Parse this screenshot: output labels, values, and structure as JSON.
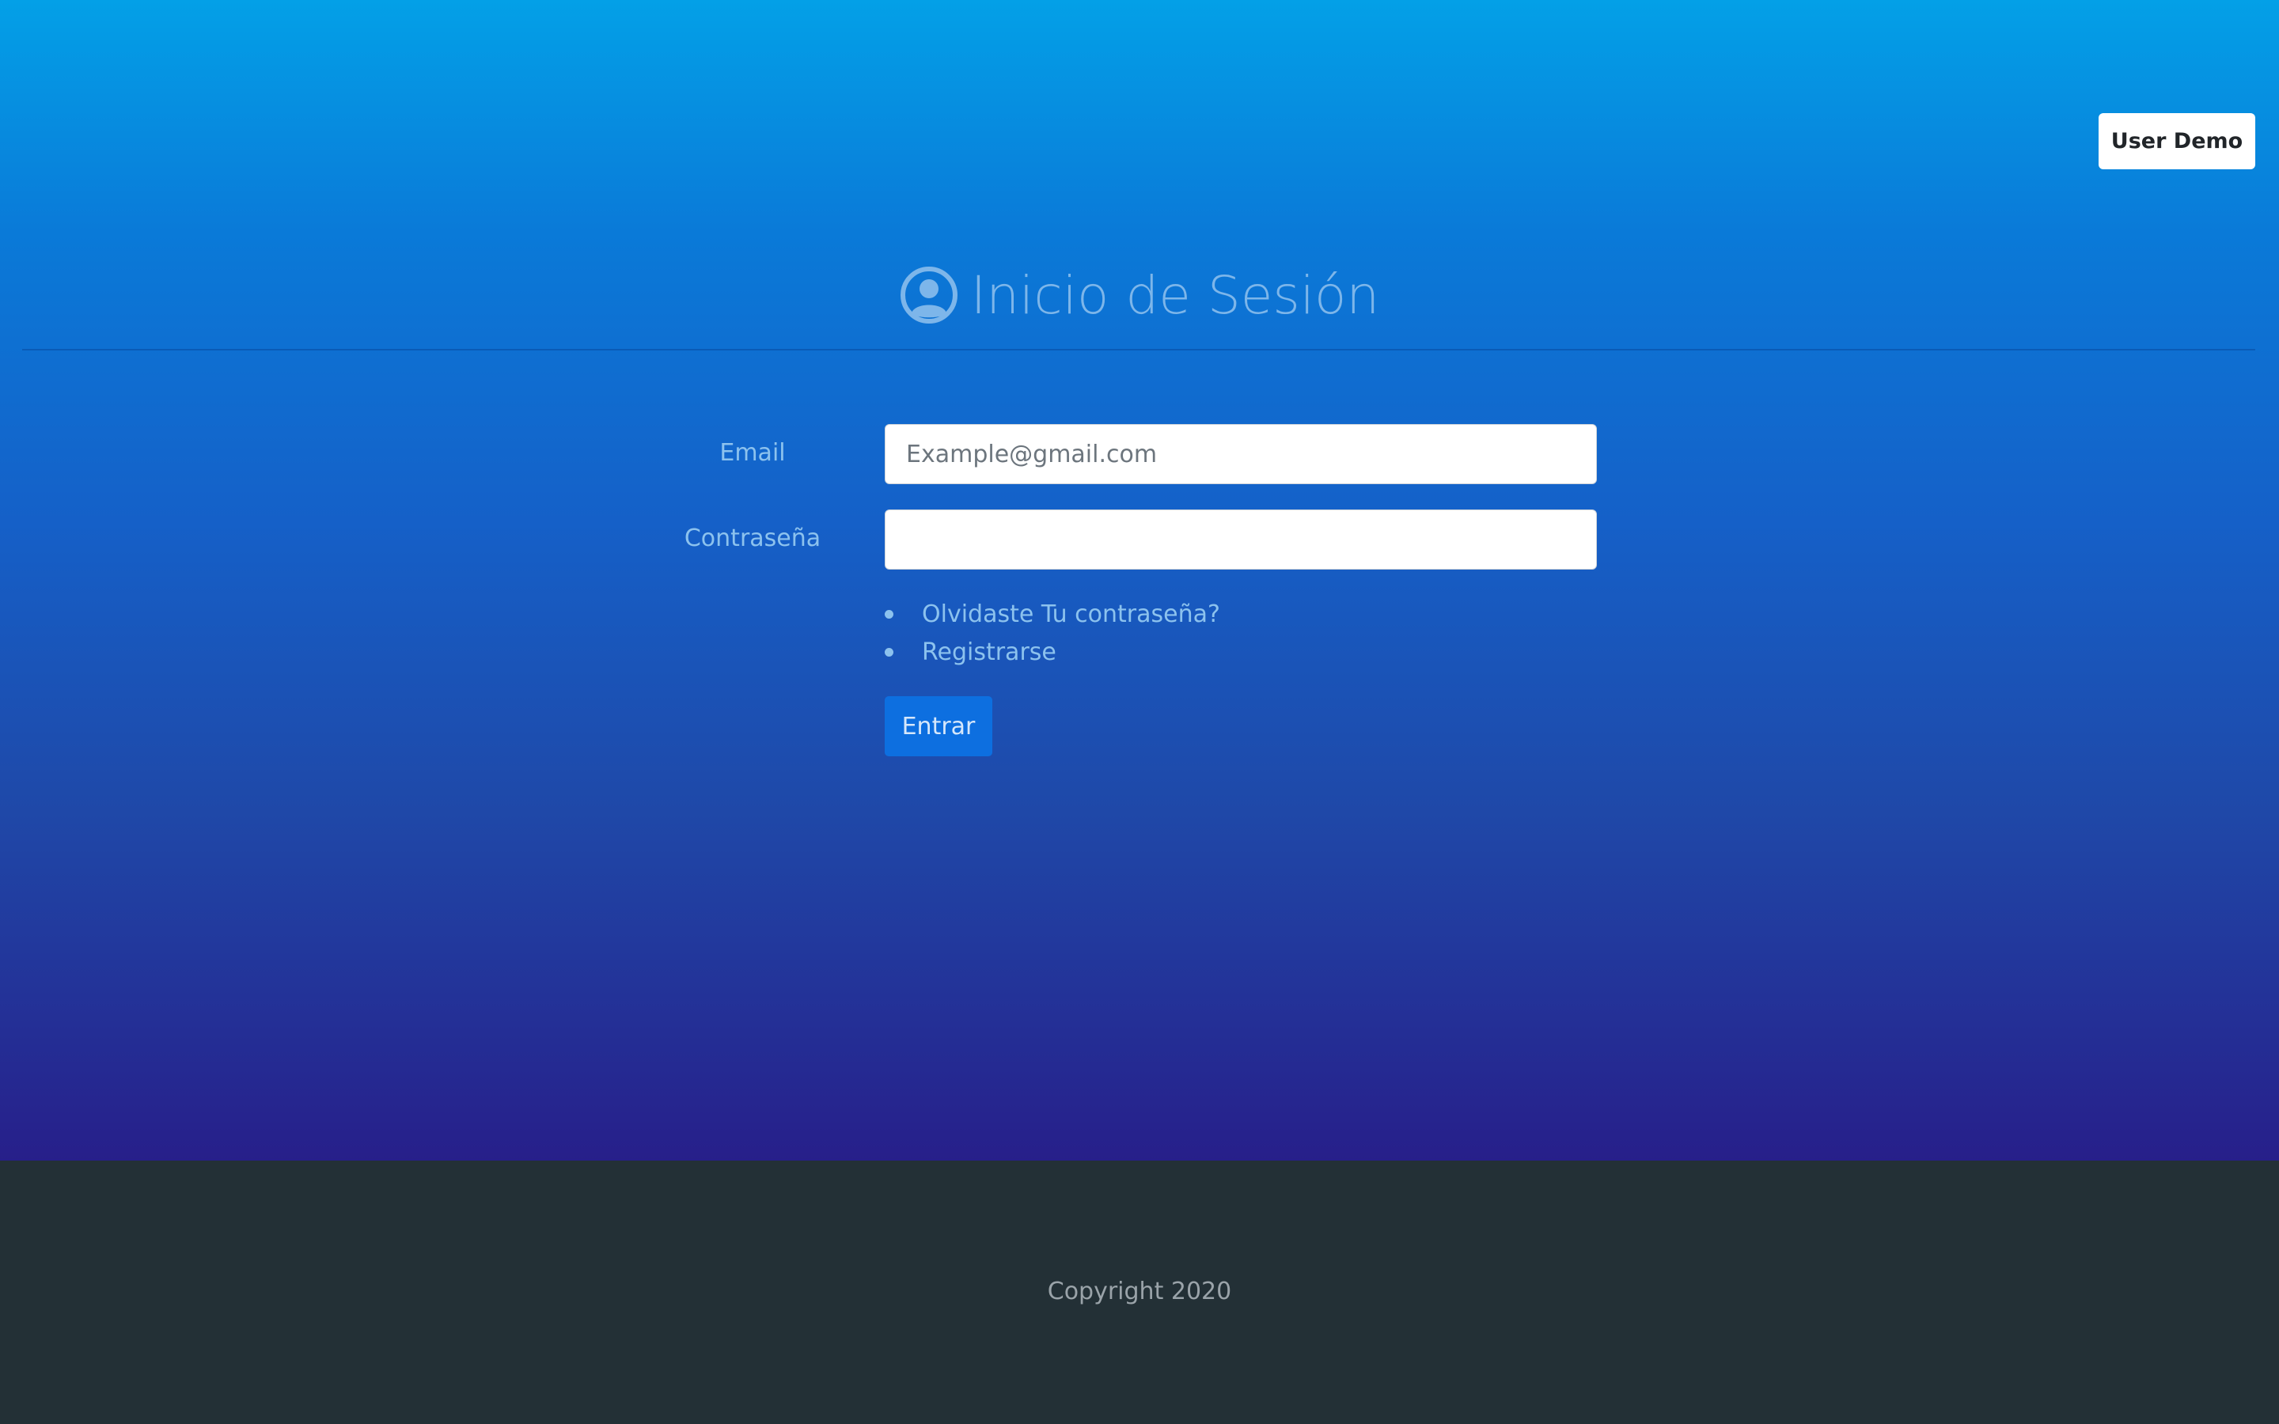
{
  "header": {
    "user_button_label": "User Demo"
  },
  "login": {
    "title": "Inicio de Sesión",
    "icon": "user-circle-icon",
    "email_label": "Email",
    "email_placeholder": "Example@gmail.com",
    "email_value": "",
    "password_label": "Contraseña",
    "password_value": "",
    "links": [
      {
        "label": "Olvidaste Tu contraseña?"
      },
      {
        "label": "Registrarse"
      }
    ],
    "submit_label": "Entrar"
  },
  "footer": {
    "copyright": "Copyright 2020"
  },
  "colors": {
    "gradient_top": "#03a0e7",
    "gradient_bottom": "#271f8a",
    "primary_button": "#0d6fe0",
    "footer_background": "#233036",
    "label_text": "#8cc2ee"
  }
}
